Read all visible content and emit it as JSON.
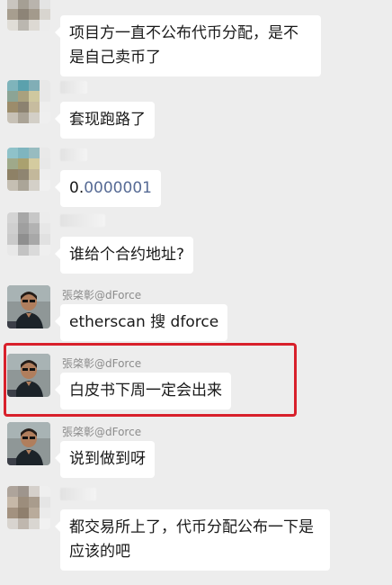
{
  "messages": [
    {
      "id": "m1",
      "sender": "",
      "text": "项目方一直不公布代币分配，是不是自己卖币了",
      "avatar": "pixelated"
    },
    {
      "id": "m2",
      "sender": "",
      "text": "套现跑路了",
      "avatar": "pixelated"
    },
    {
      "id": "m3",
      "sender": "",
      "text_prefix": "0.",
      "text_digits": "0000001",
      "avatar": "pixelated"
    },
    {
      "id": "m4",
      "sender": "",
      "text": "谁给个合约地址?",
      "avatar": "pixelated"
    },
    {
      "id": "m5",
      "sender": "張棨彰@dForce",
      "text": "etherscan 搜 dforce",
      "avatar": "photo"
    },
    {
      "id": "m6",
      "sender": "張棨彰@dForce",
      "text": "白皮书下周一定会出来",
      "avatar": "photo",
      "highlighted": true
    },
    {
      "id": "m7",
      "sender": "張棨彰@dForce",
      "text": "说到做到呀",
      "avatar": "photo"
    },
    {
      "id": "m8",
      "sender": "",
      "text": "都交易所上了，代币分配公布一下是应该的吧",
      "avatar": "pixelated"
    }
  ],
  "colors": {
    "background": "#ededed",
    "bubble": "#ffffff",
    "highlight": "#d8202b",
    "sender_name": "#8c8c8c",
    "number_blue": "#576b95"
  }
}
